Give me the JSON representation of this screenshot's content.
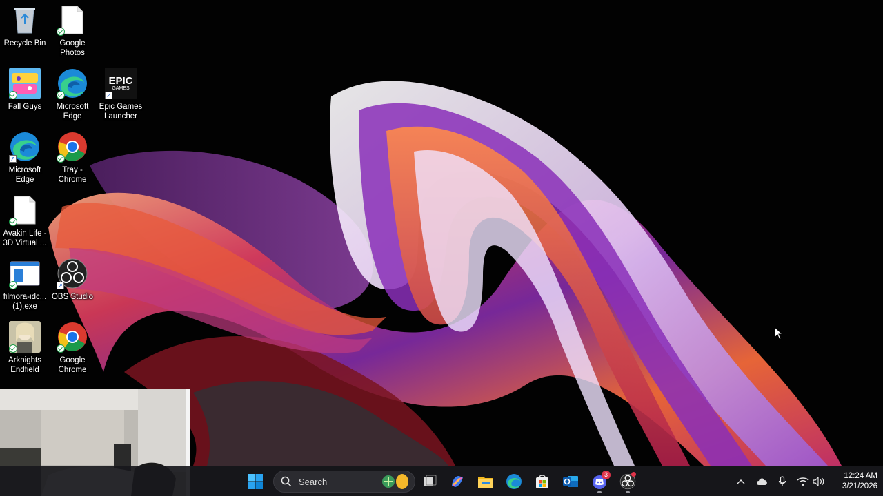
{
  "desktop": {
    "icons": [
      {
        "label": "Recycle Bin",
        "icon": "recycle-bin-icon"
      },
      {
        "label": "Google Photos",
        "icon": "blank-file-icon"
      },
      {
        "label": "Fall Guys",
        "icon": "fall-guys-icon"
      },
      {
        "label": "Microsoft Edge",
        "icon": "edge-icon"
      },
      {
        "label": "Epic Games Launcher",
        "icon": "epic-games-icon",
        "logo_text_1": "EPIC",
        "logo_text_2": "GAMES"
      },
      {
        "label": "Microsoft Edge",
        "icon": "edge-icon"
      },
      {
        "label": "Tray - Chrome",
        "icon": "chrome-icon"
      },
      {
        "label": "Avakin Life - 3D Virtual ...",
        "icon": "blank-file-icon"
      },
      {
        "label": "filmora-idc... (1).exe",
        "icon": "installer-icon"
      },
      {
        "label": "OBS Studio",
        "icon": "obs-icon"
      },
      {
        "label": "Arknights Endfield",
        "icon": "arknights-icon"
      },
      {
        "label": "Google Chrome",
        "icon": "chrome-icon"
      }
    ]
  },
  "taskbar": {
    "search_label": "Search",
    "apps": [
      {
        "name": "start",
        "icon": "windows-start-icon"
      },
      {
        "name": "search",
        "icon": "search-icon"
      },
      {
        "name": "task-view",
        "icon": "task-view-icon"
      },
      {
        "name": "copilot",
        "icon": "copilot-icon"
      },
      {
        "name": "file-explorer",
        "icon": "folder-icon"
      },
      {
        "name": "edge",
        "icon": "edge-icon"
      },
      {
        "name": "store",
        "icon": "store-icon"
      },
      {
        "name": "outlook",
        "icon": "outlook-icon"
      },
      {
        "name": "discord",
        "icon": "discord-icon",
        "badge": "3"
      },
      {
        "name": "obs",
        "icon": "obs-icon"
      }
    ],
    "tray": {
      "icons": [
        "chevron-up-icon",
        "onedrive-cloud-icon",
        "microphone-icon",
        "wifi-icon",
        "volume-icon"
      ],
      "time": "12:24 AM",
      "date": "3/21/2026"
    }
  },
  "colors": {
    "taskbar_bg": "#18181c",
    "accent_blue": "#0078d4",
    "wallpaper_bg": "#000000"
  }
}
